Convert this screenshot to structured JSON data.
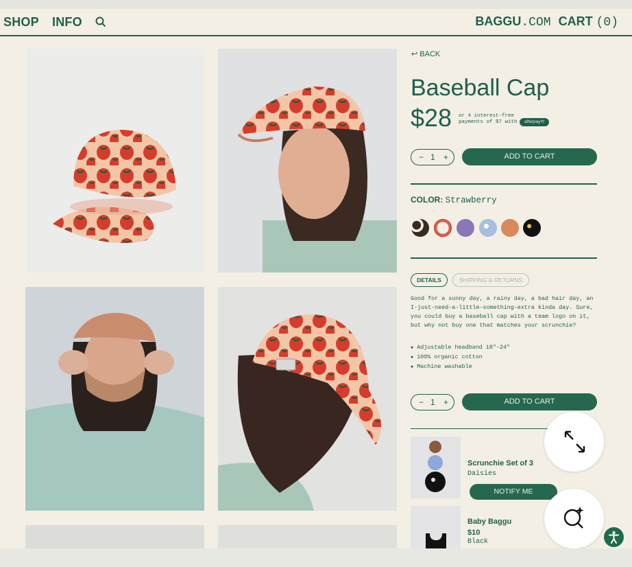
{
  "nav": {
    "shop": "SHOP",
    "info": "INFO",
    "site_bold": "BAGGU",
    "site_mono": ".COM",
    "cart_bold": "CART",
    "cart_count": "(0)"
  },
  "product": {
    "back": "↩ BACK",
    "title": "Baseball Cap",
    "price": "$28",
    "installments": "or 4 interest-free payments of $7 with",
    "afterpay": "afterpay⟲",
    "qty": "1",
    "minus": "−",
    "plus": "+",
    "add_to_cart": "ADD TO CART",
    "color_label": "COLOR:",
    "color_value": "Strawberry"
  },
  "tabs": {
    "details": "DETAILS",
    "shipping": "SHIPPING & RETURNS"
  },
  "description": "Good for a sunny day, a rainy day, a bad hair day, an I-just-need-a-little-something-extra kinda day. Sure, you could buy a baseball cap with a team logo on it, but why not buy one that matches your scrunchie?",
  "bullets": [
    "Adjustable headband 18\"-24\"",
    "100% organic cotton",
    "Machine washable"
  ],
  "related": [
    {
      "name": "Scrunchie Set of 3",
      "variant": "Daisies",
      "button": "NOTIFY ME"
    },
    {
      "name": "Baby Baggu",
      "price": "$10",
      "variant": "Black"
    }
  ],
  "colors": {
    "accent": "#1f5f4b",
    "background": "#f3efe4"
  }
}
